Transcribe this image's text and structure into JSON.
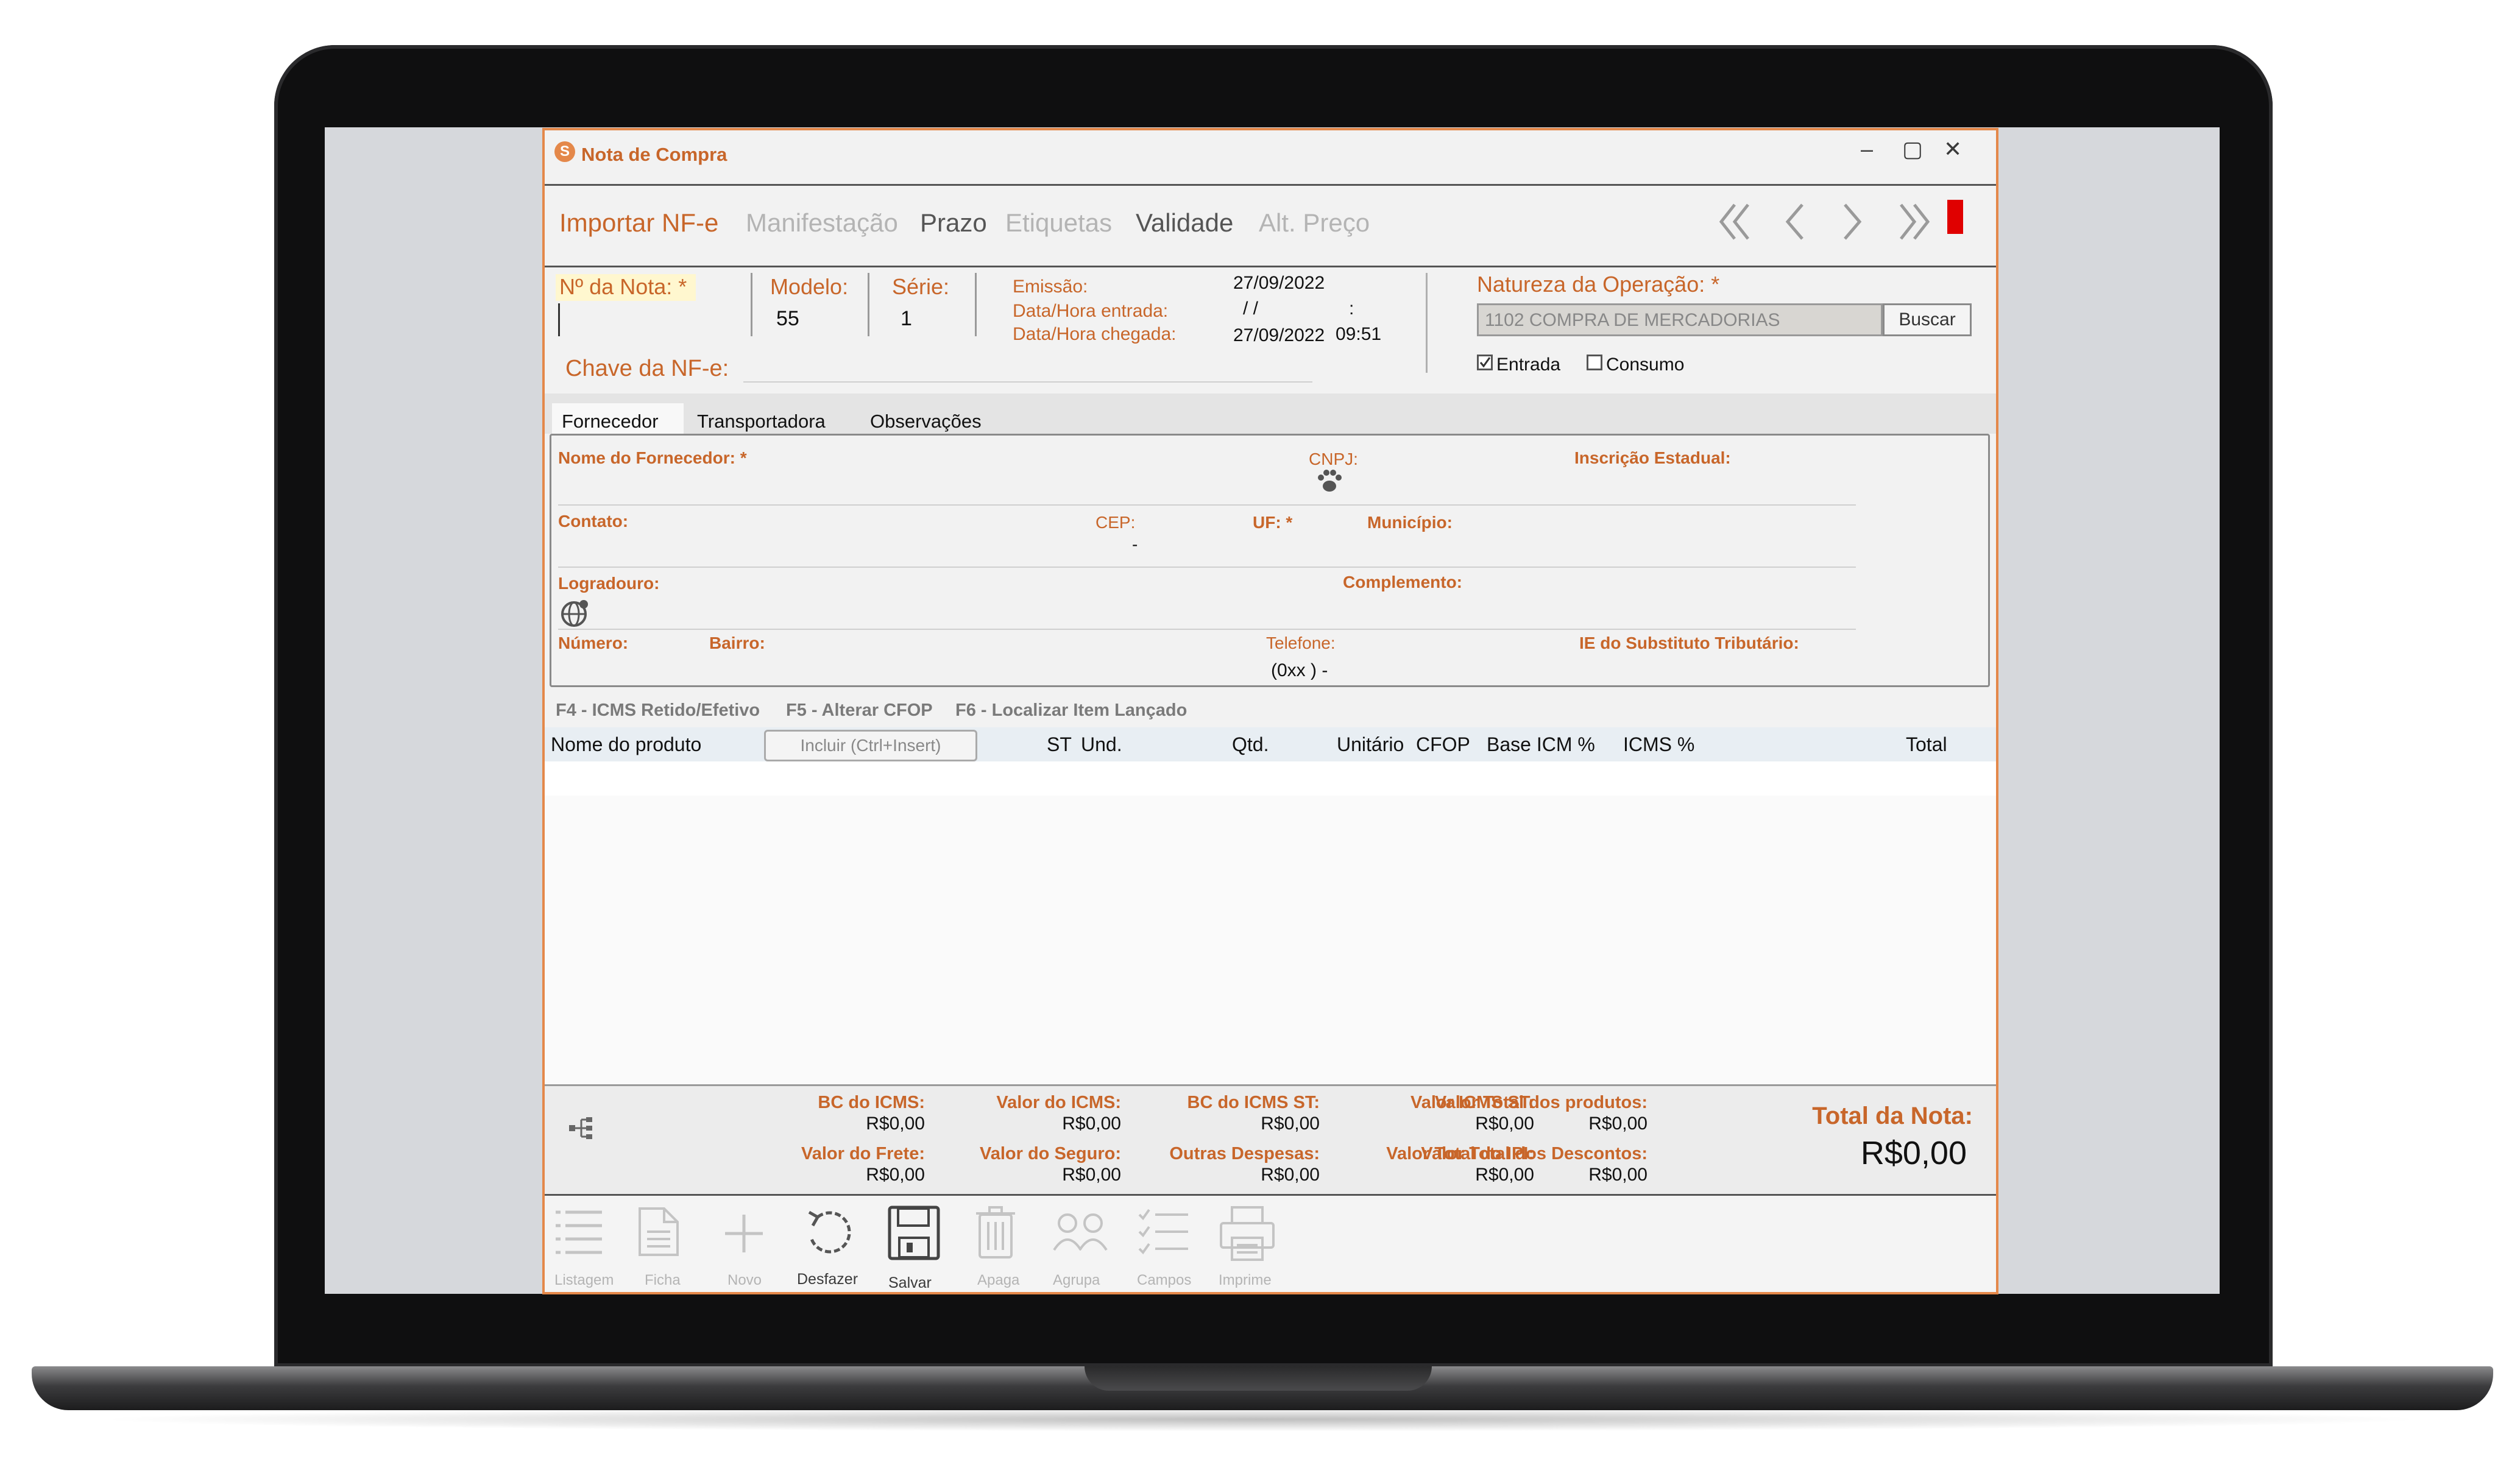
{
  "window": {
    "title": "Nota de Compra",
    "controls": {
      "minimize": "‒",
      "maximize": "▢",
      "close": "✕"
    }
  },
  "toolbar": {
    "items": [
      {
        "label": "Importar NF-e",
        "enabled": true
      },
      {
        "label": "Manifestação",
        "enabled": false
      },
      {
        "label": "Prazo",
        "enabled": true
      },
      {
        "label": "Etiquetas",
        "enabled": false
      },
      {
        "label": "Validade",
        "enabled": true
      },
      {
        "label": "Alt. Preço",
        "enabled": false
      }
    ],
    "nav_icons": [
      "first-icon",
      "prev-icon",
      "next-icon",
      "last-icon"
    ]
  },
  "header": {
    "numero_label": "Nº da Nota: *",
    "numero_value": "",
    "modelo_label": "Modelo:",
    "modelo_value": "55",
    "serie_label": "Série:",
    "serie_value": "1",
    "emissao_label": "Emissão:",
    "emissao_value": "27/09/2022",
    "entrada_label": "Data/Hora entrada:",
    "entrada_date": "/  /",
    "entrada_time": ":",
    "chegada_label": "Data/Hora chegada:",
    "chegada_date": "27/09/2022",
    "chegada_time": "09:51",
    "chave_label": "Chave da NF-e:",
    "chave_value": "",
    "natureza_label": "Natureza da Operação: *",
    "natureza_value": "1102 COMPRA DE MERCADORIAS",
    "buscar_label": "Buscar",
    "entrada_chk_label": "Entrada",
    "entrada_checked": true,
    "consumo_chk_label": "Consumo",
    "consumo_checked": false
  },
  "tabs": [
    "Fornecedor",
    "Transportadora",
    "Observações"
  ],
  "fornecedor": {
    "nome_label": "Nome do Fornecedor: *",
    "cnpj_label": "CNPJ:",
    "ie_label": "Inscrição Estadual:",
    "contato_label": "Contato:",
    "cep_label": "CEP:",
    "cep_value": "-",
    "uf_label": "UF: *",
    "municipio_label": "Município:",
    "logradouro_label": "Logradouro:",
    "complemento_label": "Complemento:",
    "numero_label": "Número:",
    "bairro_label": "Bairro:",
    "telefone_label": "Telefone:",
    "telefone_value": "(0xx )   -",
    "ie_st_label": "IE do Substituto Tributário:"
  },
  "shortcuts": [
    "F4 - ICMS Retido/Efetivo",
    "F5 - Alterar CFOP",
    "F6 - Localizar Item Lançado"
  ],
  "items_table": {
    "incluir_label": "Incluir (Ctrl+Insert)",
    "columns": [
      "Nome do produto",
      "ST",
      "Und.",
      "Qtd.",
      "Unitário",
      "CFOP",
      "Base ICM %",
      "ICMS %",
      "Total"
    ],
    "rows": []
  },
  "totals": {
    "bc_icms_label": "BC do ICMS:",
    "bc_icms": "R$0,00",
    "valor_icms_label": "Valor do ICMS:",
    "valor_icms": "R$0,00",
    "bc_icms_st_label": "BC do ICMS ST:",
    "bc_icms_st": "R$0,00",
    "valor_icms_st_label": "Valor ICMS ST:",
    "valor_icms_st": "R$0,00",
    "total_produtos_label": "Valor Total dos produtos:",
    "total_produtos": "R$0,00",
    "frete_label": "Valor do Frete:",
    "frete": "R$0,00",
    "seguro_label": "Valor do Seguro:",
    "seguro": "R$0,00",
    "outras_label": "Outras Despesas:",
    "outras": "R$0,00",
    "ipi_label": "Valor Total do IPI:",
    "ipi": "R$0,00",
    "descontos_label": "Valor Total dos Descontos:",
    "descontos": "R$0,00",
    "total_nota_label": "Total da Nota:",
    "total_nota": "R$0,00"
  },
  "bottom_bar": [
    {
      "label": "Listagem",
      "icon": "list-icon",
      "enabled": false
    },
    {
      "label": "Ficha",
      "icon": "document-icon",
      "enabled": false
    },
    {
      "label": "Novo",
      "icon": "plus-icon",
      "enabled": false
    },
    {
      "label": "Desfazer",
      "icon": "undo-icon",
      "enabled": true
    },
    {
      "label": "Salvar",
      "icon": "save-icon",
      "enabled": true
    },
    {
      "label": "Apaga",
      "icon": "trash-icon",
      "enabled": false
    },
    {
      "label": "Agrupa",
      "icon": "group-icon",
      "enabled": false
    },
    {
      "label": "Campos",
      "icon": "checklist-icon",
      "enabled": false
    },
    {
      "label": "Imprime",
      "icon": "printer-icon",
      "enabled": false
    }
  ],
  "colors": {
    "accent": "#c8662a",
    "window_border": "#e4884a",
    "disabled": "#b4b4b4",
    "flag": "#e00000"
  }
}
